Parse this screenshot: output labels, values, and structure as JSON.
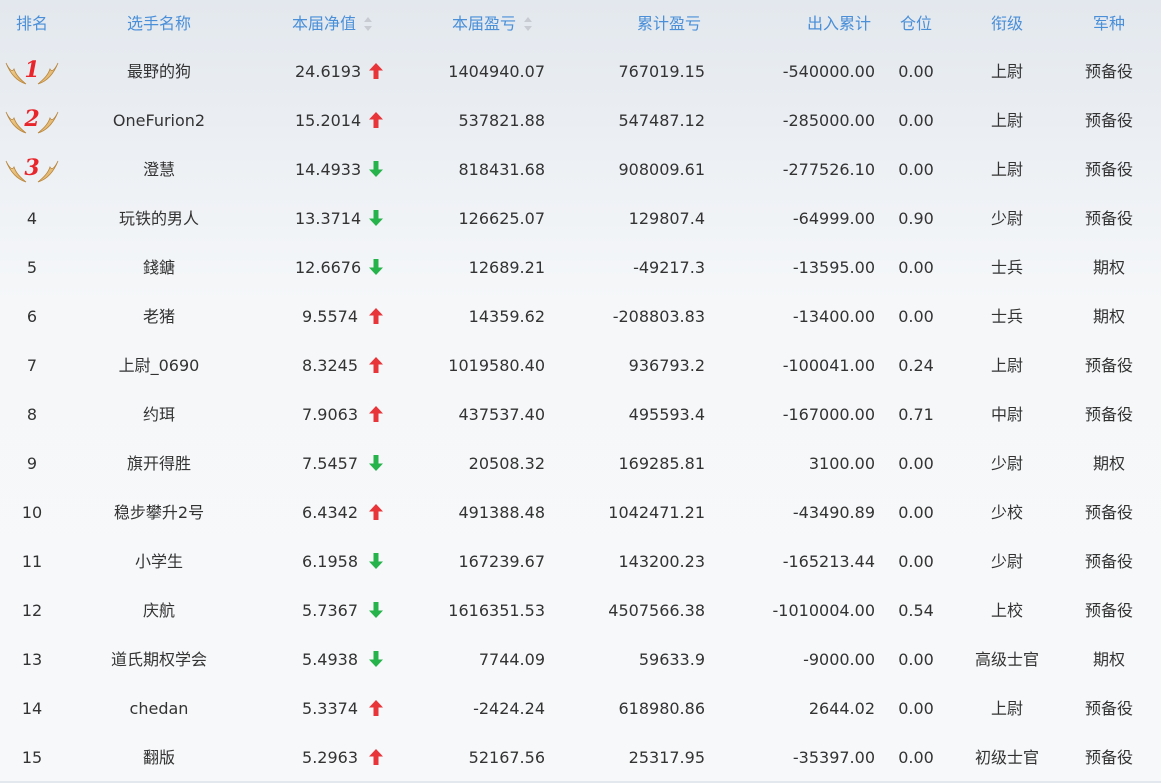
{
  "headers": {
    "rank": "排名",
    "name": "选手名称",
    "nav": "本届净值",
    "pl": "本届盈亏",
    "cum": "累计盈亏",
    "io": "出入累计",
    "pos": "仓位",
    "military_rank": "衔级",
    "branch": "军种"
  },
  "colors": {
    "header_text": "#4a8fd8",
    "up_arrow": "#e8353a",
    "down_arrow": "#27b34b",
    "medal_number": "#e8252b",
    "medal_wing": "#d9a452"
  },
  "rows": [
    {
      "rank": "1",
      "medal": true,
      "name": "最野的狗",
      "nav": "24.6193",
      "trend": "up",
      "pl": "1404940.07",
      "cum": "767019.15",
      "io": "-540000.00",
      "pos": "0.00",
      "military_rank": "上尉",
      "branch": "预备役"
    },
    {
      "rank": "2",
      "medal": true,
      "name": "OneFurion2",
      "nav": "15.2014",
      "trend": "up",
      "pl": "537821.88",
      "cum": "547487.12",
      "io": "-285000.00",
      "pos": "0.00",
      "military_rank": "上尉",
      "branch": "预备役"
    },
    {
      "rank": "3",
      "medal": true,
      "name": "澄慧",
      "nav": "14.4933",
      "trend": "down",
      "pl": "818431.68",
      "cum": "908009.61",
      "io": "-277526.10",
      "pos": "0.00",
      "military_rank": "上尉",
      "branch": "预备役"
    },
    {
      "rank": "4",
      "medal": false,
      "name": "玩铁的男人",
      "nav": "13.3714",
      "trend": "down",
      "pl": "126625.07",
      "cum": "129807.4",
      "io": "-64999.00",
      "pos": "0.90",
      "military_rank": "少尉",
      "branch": "预备役"
    },
    {
      "rank": "5",
      "medal": false,
      "name": "錢鎕",
      "nav": "12.6676",
      "trend": "down",
      "pl": "12689.21",
      "cum": "-49217.3",
      "io": "-13595.00",
      "pos": "0.00",
      "military_rank": "士兵",
      "branch": "期权"
    },
    {
      "rank": "6",
      "medal": false,
      "name": "老猪",
      "nav": "9.5574",
      "trend": "up",
      "pl": "14359.62",
      "cum": "-208803.83",
      "io": "-13400.00",
      "pos": "0.00",
      "military_rank": "士兵",
      "branch": "期权"
    },
    {
      "rank": "7",
      "medal": false,
      "name": "上尉_0690",
      "nav": "8.3245",
      "trend": "up",
      "pl": "1019580.40",
      "cum": "936793.2",
      "io": "-100041.00",
      "pos": "0.24",
      "military_rank": "上尉",
      "branch": "预备役"
    },
    {
      "rank": "8",
      "medal": false,
      "name": "约珥",
      "nav": "7.9063",
      "trend": "up",
      "pl": "437537.40",
      "cum": "495593.4",
      "io": "-167000.00",
      "pos": "0.71",
      "military_rank": "中尉",
      "branch": "预备役"
    },
    {
      "rank": "9",
      "medal": false,
      "name": "旗开得胜",
      "nav": "7.5457",
      "trend": "down",
      "pl": "20508.32",
      "cum": "169285.81",
      "io": "3100.00",
      "pos": "0.00",
      "military_rank": "少尉",
      "branch": "期权"
    },
    {
      "rank": "10",
      "medal": false,
      "name": "稳步攀升2号",
      "nav": "6.4342",
      "trend": "up",
      "pl": "491388.48",
      "cum": "1042471.21",
      "io": "-43490.89",
      "pos": "0.00",
      "military_rank": "少校",
      "branch": "预备役"
    },
    {
      "rank": "11",
      "medal": false,
      "name": "小学生",
      "nav": "6.1958",
      "trend": "down",
      "pl": "167239.67",
      "cum": "143200.23",
      "io": "-165213.44",
      "pos": "0.00",
      "military_rank": "少尉",
      "branch": "预备役"
    },
    {
      "rank": "12",
      "medal": false,
      "name": "庆航",
      "nav": "5.7367",
      "trend": "down",
      "pl": "1616351.53",
      "cum": "4507566.38",
      "io": "-1010004.00",
      "pos": "0.54",
      "military_rank": "上校",
      "branch": "预备役"
    },
    {
      "rank": "13",
      "medal": false,
      "name": "道氏期权学会",
      "nav": "5.4938",
      "trend": "down",
      "pl": "7744.09",
      "cum": "59633.9",
      "io": "-9000.00",
      "pos": "0.00",
      "military_rank": "高级士官",
      "branch": "期权"
    },
    {
      "rank": "14",
      "medal": false,
      "name": "chedan",
      "nav": "5.3374",
      "trend": "up",
      "pl": "-2424.24",
      "cum": "618980.86",
      "io": "2644.02",
      "pos": "0.00",
      "military_rank": "上尉",
      "branch": "预备役"
    },
    {
      "rank": "15",
      "medal": false,
      "name": "翻版",
      "nav": "5.2963",
      "trend": "up",
      "pl": "52167.56",
      "cum": "25317.95",
      "io": "-35397.00",
      "pos": "0.00",
      "military_rank": "初级士官",
      "branch": "预备役"
    }
  ]
}
